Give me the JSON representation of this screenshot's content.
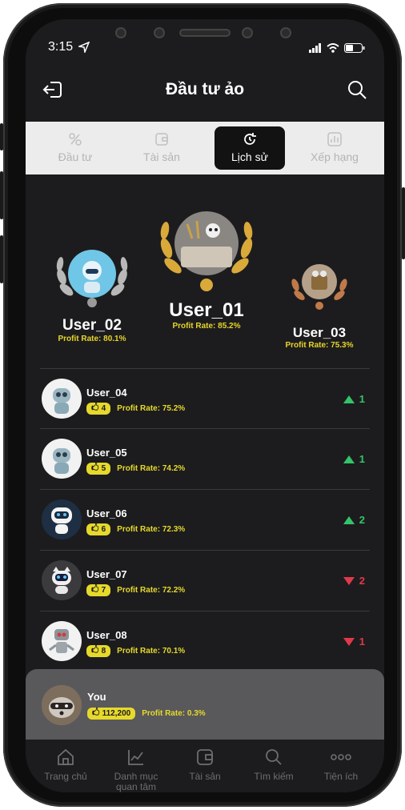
{
  "status": {
    "time": "3:15"
  },
  "header": {
    "title": "Đầu tư ảo"
  },
  "tabs": [
    {
      "label": "Đầu tư",
      "icon": "invest-icon",
      "active": false
    },
    {
      "label": "Tài sản",
      "icon": "wallet-icon",
      "active": false
    },
    {
      "label": "Lịch sử",
      "icon": "history-icon",
      "active": true
    },
    {
      "label": "Xếp hạng",
      "icon": "ranking-icon",
      "active": false
    }
  ],
  "podium": {
    "first": {
      "name": "User_01",
      "rate": "Profit Rate: 85.2%"
    },
    "second": {
      "name": "User_02",
      "rate": "Profit Rate: 80.1%"
    },
    "third": {
      "name": "User_03",
      "rate": "Profit Rate: 75.3%"
    }
  },
  "ranking": [
    {
      "name": "User_04",
      "rank": "4",
      "rate": "Profit Rate: 75.2%",
      "trend": "1",
      "direction": "up"
    },
    {
      "name": "User_05",
      "rank": "5",
      "rate": "Profit Rate: 74.2%",
      "trend": "1",
      "direction": "up"
    },
    {
      "name": "User_06",
      "rank": "6",
      "rate": "Profit Rate: 72.3%",
      "trend": "2",
      "direction": "up"
    },
    {
      "name": "User_07",
      "rank": "7",
      "rate": "Profit Rate: 72.2%",
      "trend": "2",
      "direction": "down"
    },
    {
      "name": "User_08",
      "rank": "8",
      "rate": "Profit Rate: 70.1%",
      "trend": "1",
      "direction": "down"
    }
  ],
  "you": {
    "name": "You",
    "rank": "112,200",
    "rate": "Profit Rate: 0.3%"
  },
  "bottom_nav": [
    {
      "label": "Trang chủ",
      "icon": "home-icon"
    },
    {
      "label": "Danh mục quan tâm",
      "icon": "chart-icon"
    },
    {
      "label": "Tài sản",
      "icon": "wallet-icon"
    },
    {
      "label": "Tìm kiếm",
      "icon": "search-icon"
    },
    {
      "label": "Tiện ích",
      "icon": "more-icon"
    }
  ],
  "colors": {
    "accent": "#e6d92c",
    "up": "#34c36a",
    "down": "#e0394c",
    "background": "#1c1c1e"
  }
}
